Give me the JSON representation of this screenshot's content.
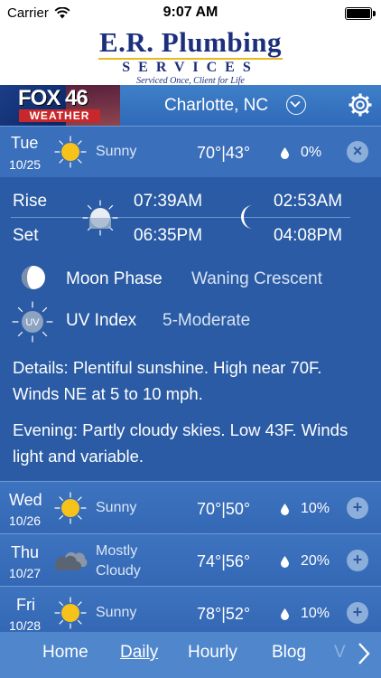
{
  "status": {
    "carrier": "Carrier",
    "time": "9:07 AM"
  },
  "sponsor": {
    "name": "E.R. Plumbing",
    "subtitle": "SERVICES",
    "tagline": "Serviced Once, Client for Life"
  },
  "header": {
    "logo_top": "FOX 46",
    "logo_bottom": "WEATHER",
    "location": "Charlotte, NC"
  },
  "today": {
    "day": "Tue",
    "date": "10/25",
    "condition": "Sunny",
    "temps": "70°|43°",
    "precip": "0%",
    "close_label": "×"
  },
  "sun_moon": {
    "rise_label": "Rise",
    "set_label": "Set",
    "sunrise": "07:39AM",
    "sunset": "06:35PM",
    "moonrise": "02:53AM",
    "moonset": "04:08PM"
  },
  "moon_phase": {
    "label": "Moon Phase",
    "value": "Waning Crescent"
  },
  "uv_index": {
    "icon_text": "UV",
    "label": "UV Index",
    "value": "5-Moderate"
  },
  "details_text": "Details: Plentiful sunshine. High near 70F. Winds NE at 5 to 10 mph.",
  "evening_text": "Evening: Partly cloudy skies. Low 43F. Winds light and variable.",
  "forecast": [
    {
      "day": "Wed",
      "date": "10/26",
      "condition": "Sunny",
      "icon": "sun-icon",
      "temps": "70°|50°",
      "precip": "10%",
      "expand_label": "+"
    },
    {
      "day": "Thu",
      "date": "10/27",
      "condition_line1": "Mostly",
      "condition_line2": "Cloudy",
      "icon": "cloud-icon",
      "temps": "74°|56°",
      "precip": "20%",
      "expand_label": "+"
    },
    {
      "day": "Fri",
      "date": "10/28",
      "condition": "Sunny",
      "icon": "sun-icon",
      "temps": "78°|52°",
      "precip": "10%",
      "expand_label": "+"
    }
  ],
  "nav": {
    "items": [
      "Home",
      "Daily",
      "Hourly",
      "Blog",
      "V"
    ],
    "active": "Daily"
  },
  "colors": {
    "background": "#2b5aa0",
    "sun": "#f7c21a",
    "alert_red": "#c8282b"
  }
}
